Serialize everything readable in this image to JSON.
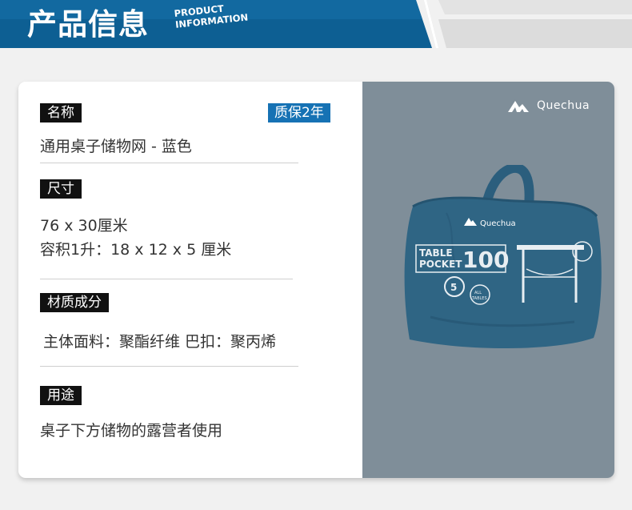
{
  "header": {
    "title": "产品信息",
    "subtitle_line1": "PRODUCT",
    "subtitle_line2": "INFORMATION",
    "colors": {
      "banner": "#0d5f93",
      "banner_edge": "#1d7ab8"
    }
  },
  "name_section": {
    "label": "名称",
    "warranty": "质保2年",
    "value": "通用桌子储物网 - 蓝色"
  },
  "size_section": {
    "label": "尺寸",
    "line1": "76 x 30厘米",
    "line2": "容积1升：18 x 12 x 5 厘米"
  },
  "material_section": {
    "label": "材质成分",
    "value": "主体面料：聚酯纤维 巴扣：聚丙烯"
  },
  "usage_section": {
    "label": "用途",
    "value": "桌子下方储物的露营者使用"
  },
  "image_panel": {
    "brand": "Quechua",
    "bag_brand": "Quechua",
    "bag_text_line1": "TABLE",
    "bag_text_line2": "POCKET",
    "bag_number": "100",
    "badge_number": "5",
    "badge_all": "ALL",
    "badge_tables": "TABLES",
    "colors": {
      "panel": "#7f8e99",
      "bag": "#2f6584",
      "accent": "#1672b4"
    }
  }
}
